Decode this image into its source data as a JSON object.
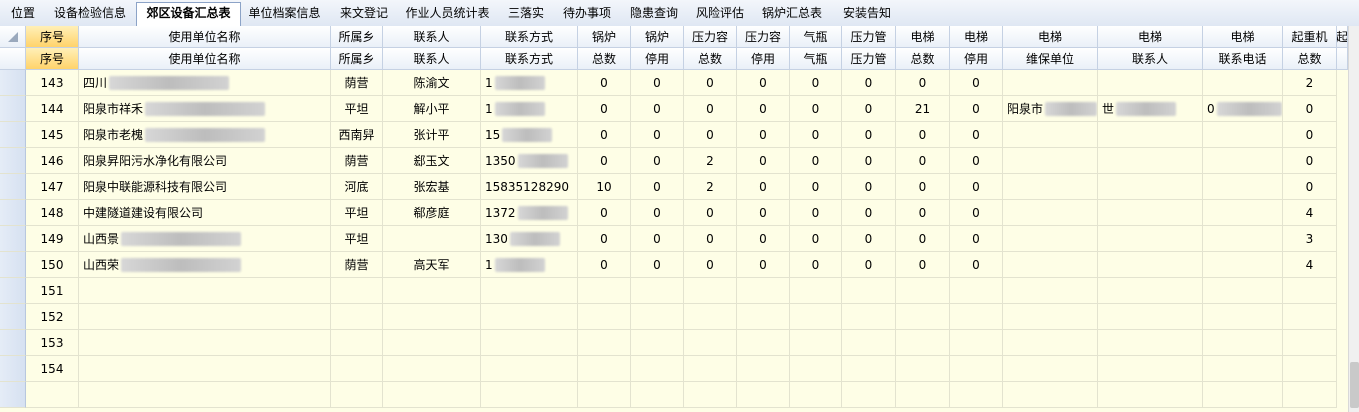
{
  "tabs": [
    {
      "label": "位置"
    },
    {
      "label": "设备检验信息"
    },
    {
      "label": "郊区设备汇总表",
      "active": true
    },
    {
      "label": "单位档案信息"
    },
    {
      "label": "来文登记"
    },
    {
      "label": "作业人员统计表"
    },
    {
      "label": "三落实"
    },
    {
      "label": "待办事项"
    },
    {
      "label": "隐患查询"
    },
    {
      "label": "风险评估"
    },
    {
      "label": "锅炉汇总表"
    },
    {
      "label": "安装告知"
    }
  ],
  "columns_row1": [
    "序号",
    "使用单位名称",
    "所属乡",
    "联系人",
    "联系方式",
    "锅炉",
    "锅炉",
    "压力容",
    "压力容",
    "气瓶",
    "压力管",
    "电梯",
    "电梯",
    "电梯",
    "电梯",
    "电梯",
    "起重机",
    "起"
  ],
  "columns_row2": [
    "序号",
    "使用单位名称",
    "所属乡",
    "联系人",
    "联系方式",
    "总数",
    "停用",
    "总数",
    "停用",
    "气瓶",
    "压力管",
    "总数",
    "停用",
    "维保单位",
    "联系人",
    "联系电话",
    "总数",
    ""
  ],
  "rows": [
    {
      "seq": "143",
      "unit": "四川",
      "town": "荫营",
      "contact": "陈渝文",
      "phone": "1",
      "c5": "0",
      "c6": "0",
      "c7": "0",
      "c8": "0",
      "c9": "0",
      "c10": "0",
      "c11": "0",
      "c12": "0",
      "maint": "",
      "mcontact": "",
      "mphone": "",
      "crane": "2"
    },
    {
      "seq": "144",
      "unit": "阳泉市祥禾",
      "town": "平坦",
      "contact": "解小平",
      "phone": "1",
      "c5": "0",
      "c6": "0",
      "c7": "0",
      "c8": "0",
      "c9": "0",
      "c10": "0",
      "c11": "21",
      "c12": "0",
      "maint": "阳泉市",
      "mcontact": "世",
      "mphone": "0",
      "crane": "0"
    },
    {
      "seq": "145",
      "unit": "阳泉市老槐",
      "town": "西南舁",
      "contact": "张计平",
      "phone": "15",
      "c5": "0",
      "c6": "0",
      "c7": "0",
      "c8": "0",
      "c9": "0",
      "c10": "0",
      "c11": "0",
      "c12": "0",
      "maint": "",
      "mcontact": "",
      "mphone": "",
      "crane": "0"
    },
    {
      "seq": "146",
      "unit": "阳泉昇阳污水净化有限公司",
      "town": "荫营",
      "contact": "郄玉文",
      "phone": "1350",
      "c5": "0",
      "c6": "0",
      "c7": "2",
      "c8": "0",
      "c9": "0",
      "c10": "0",
      "c11": "0",
      "c12": "0",
      "maint": "",
      "mcontact": "",
      "mphone": "",
      "crane": "0"
    },
    {
      "seq": "147",
      "unit": "阳泉中联能源科技有限公司",
      "town": "河底",
      "contact": "张宏基",
      "phone": "15835128290",
      "c5": "10",
      "c6": "0",
      "c7": "2",
      "c8": "0",
      "c9": "0",
      "c10": "0",
      "c11": "0",
      "c12": "0",
      "maint": "",
      "mcontact": "",
      "mphone": "",
      "crane": "0"
    },
    {
      "seq": "148",
      "unit": "中建隧道建设有限公司",
      "town": "平坦",
      "contact": "郗彦庭",
      "phone": "1372",
      "c5": "0",
      "c6": "0",
      "c7": "0",
      "c8": "0",
      "c9": "0",
      "c10": "0",
      "c11": "0",
      "c12": "0",
      "maint": "",
      "mcontact": "",
      "mphone": "",
      "crane": "4"
    },
    {
      "seq": "149",
      "unit": "山西景",
      "town": "平坦",
      "contact": "",
      "phone": "130",
      "c5": "0",
      "c6": "0",
      "c7": "0",
      "c8": "0",
      "c9": "0",
      "c10": "0",
      "c11": "0",
      "c12": "0",
      "maint": "",
      "mcontact": "",
      "mphone": "",
      "crane": "3"
    },
    {
      "seq": "150",
      "unit": "山西荣",
      "town": "荫营",
      "contact": "高天军",
      "phone": "1",
      "c5": "0",
      "c6": "0",
      "c7": "0",
      "c8": "0",
      "c9": "0",
      "c10": "0",
      "c11": "0",
      "c12": "0",
      "maint": "",
      "mcontact": "",
      "mphone": "",
      "crane": "4"
    },
    {
      "seq": "151"
    },
    {
      "seq": "152"
    },
    {
      "seq": "153"
    },
    {
      "seq": "154"
    }
  ]
}
